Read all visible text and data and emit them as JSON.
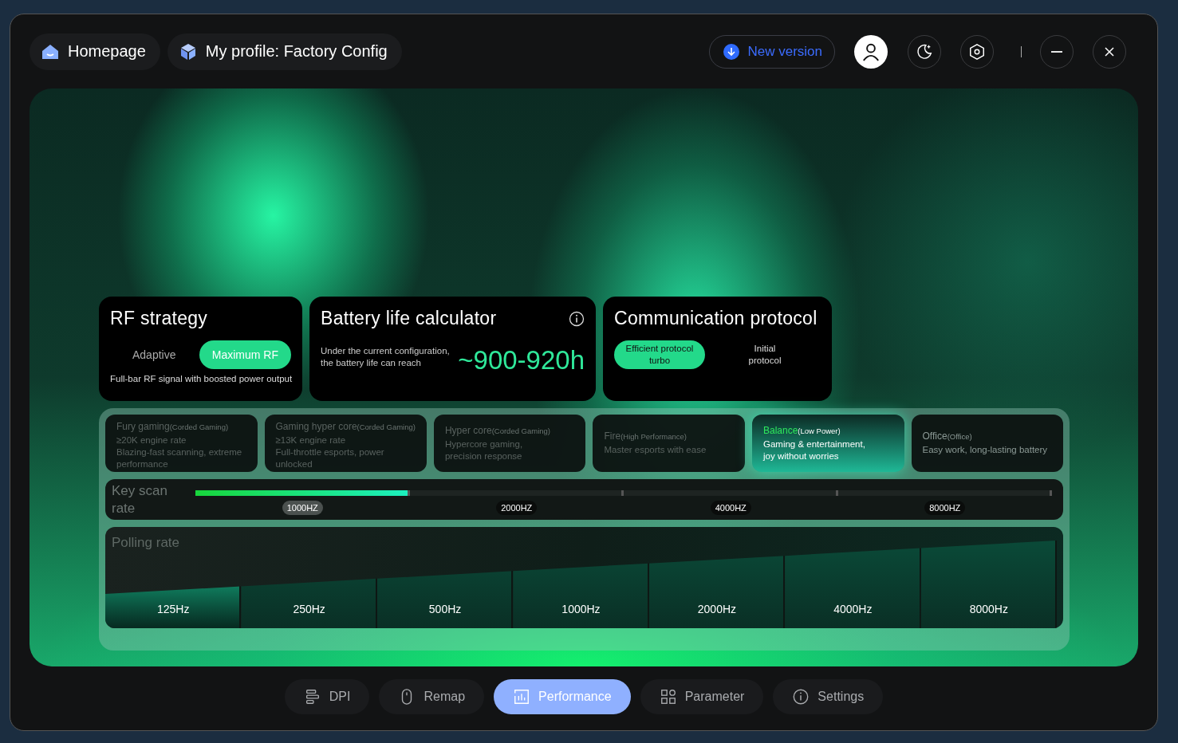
{
  "header": {
    "tabs": [
      {
        "kind": "home",
        "label": "Homepage"
      },
      {
        "kind": "profile",
        "label": "My profile: Factory Config"
      }
    ],
    "update_button": "New version"
  },
  "rf_strategy": {
    "title": "RF strategy",
    "options": [
      {
        "label": "Adaptive",
        "selected": false
      },
      {
        "label": "Maximum RF",
        "selected": true
      }
    ],
    "description": "Full-bar RF signal with boosted power output"
  },
  "battery": {
    "title": "Battery life calculator",
    "note_lines": [
      "Under the current configuration,",
      "the battery life can reach"
    ],
    "value": "~900-920h"
  },
  "protocol": {
    "title": "Communication protocol",
    "options": [
      {
        "label_lines": [
          "Efficient protocol",
          "turbo"
        ],
        "selected": true
      },
      {
        "label_lines": [
          "Initial",
          "protocol"
        ],
        "selected": false
      }
    ]
  },
  "modes": [
    {
      "name": "Fury gaming",
      "mode": "(Corded Gaming)",
      "lines": [
        "≥20K engine rate",
        "Blazing-fast scanning, extreme performance"
      ],
      "selected": false,
      "disabled": true
    },
    {
      "name": "Gaming hyper core",
      "mode": "(Corded Gaming)",
      "lines": [
        "≥13K engine rate",
        "Full-throttle esports, power unlocked"
      ],
      "selected": false,
      "disabled": true
    },
    {
      "name": "Hyper core",
      "mode": "(Corded Gaming)",
      "lines": [
        "Hypercore gaming,",
        "precision response"
      ],
      "selected": false,
      "disabled": true
    },
    {
      "name": "Fire",
      "mode": "(High Performance)",
      "lines": [
        "Master esports with ease"
      ],
      "selected": false,
      "disabled": true
    },
    {
      "name": "Balance",
      "mode": "(Low Power)",
      "lines": [
        "Gaming & entertainment,",
        "joy without worries"
      ],
      "selected": true,
      "disabled": false
    },
    {
      "name": "Office",
      "mode": "(Office)",
      "lines": [
        "Easy work, long-lasting battery"
      ],
      "selected": false,
      "disabled": false
    }
  ],
  "key_scan": {
    "label": "Key scan rate",
    "level": 0.25,
    "stops": [
      {
        "label": "1000HZ",
        "selected": true
      },
      {
        "label": "2000HZ",
        "selected": false
      },
      {
        "label": "4000HZ",
        "selected": false
      },
      {
        "label": "8000HZ",
        "selected": false
      }
    ]
  },
  "polling": {
    "label": "Polling rate",
    "options": [
      {
        "label": "125Hz",
        "selected": true
      },
      {
        "label": "250Hz",
        "selected": false
      },
      {
        "label": "500Hz",
        "selected": false
      },
      {
        "label": "1000Hz",
        "selected": false
      },
      {
        "label": "2000Hz",
        "selected": false
      },
      {
        "label": "4000Hz",
        "selected": false
      },
      {
        "label": "8000Hz",
        "selected": false
      }
    ]
  },
  "nav": [
    {
      "kind": "dpi",
      "label": "DPI",
      "selected": false
    },
    {
      "kind": "remap",
      "label": "Remap",
      "selected": false
    },
    {
      "kind": "performance",
      "label": "Performance",
      "selected": true
    },
    {
      "kind": "parameter",
      "label": "Parameter",
      "selected": false
    },
    {
      "kind": "settings",
      "label": "Settings",
      "selected": false
    }
  ]
}
